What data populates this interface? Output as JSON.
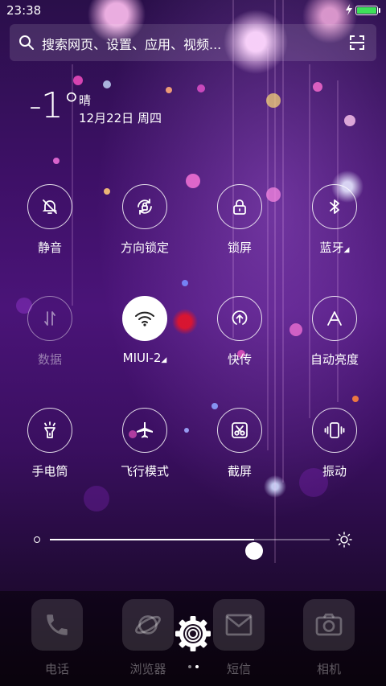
{
  "status_bar": {
    "time": "23:38",
    "battery_color": "#3ee05a"
  },
  "search": {
    "placeholder": "搜索网页、设置、应用、视频...",
    "icon": "search-icon",
    "scan_icon": "scan-icon"
  },
  "weather": {
    "temperature": "-1°",
    "condition": "晴",
    "date": "12月22日 周四"
  },
  "toggles": [
    {
      "id": "mute",
      "label": "静音",
      "icon": "bell-off-icon",
      "state": "off"
    },
    {
      "id": "rotation-lock",
      "label": "方向锁定",
      "icon": "rotation-lock-icon",
      "state": "off"
    },
    {
      "id": "lock-screen",
      "label": "锁屏",
      "icon": "lock-icon",
      "state": "off"
    },
    {
      "id": "bluetooth",
      "label": "蓝牙",
      "icon": "bluetooth-icon",
      "state": "off"
    },
    {
      "id": "data",
      "label": "数据",
      "icon": "mobile-data-icon",
      "state": "disabled"
    },
    {
      "id": "wifi",
      "label": "MIUI-2",
      "icon": "wifi-icon",
      "state": "on"
    },
    {
      "id": "quick-transfer",
      "label": "快传",
      "icon": "upload-icon",
      "state": "off"
    },
    {
      "id": "auto-brightness",
      "label": "自动亮度",
      "icon": "auto-brightness-icon",
      "state": "off"
    },
    {
      "id": "flashlight",
      "label": "手电筒",
      "icon": "flashlight-icon",
      "state": "off"
    },
    {
      "id": "airplane",
      "label": "飞行模式",
      "icon": "airplane-icon",
      "state": "off"
    },
    {
      "id": "screenshot",
      "label": "截屏",
      "icon": "scissors-icon",
      "state": "off"
    },
    {
      "id": "vibrate",
      "label": "振动",
      "icon": "vibrate-icon",
      "state": "off"
    }
  ],
  "brightness": {
    "level": 0.73
  },
  "dock": {
    "apps": [
      {
        "label": "电话",
        "icon": "phone-icon"
      },
      {
        "label": "浏览器",
        "icon": "browser-icon"
      },
      {
        "label": "短信",
        "icon": "message-icon"
      },
      {
        "label": "相机",
        "icon": "camera-icon"
      }
    ],
    "settings_icon": "gear-icon",
    "page_count": 2,
    "current_page": 2
  }
}
